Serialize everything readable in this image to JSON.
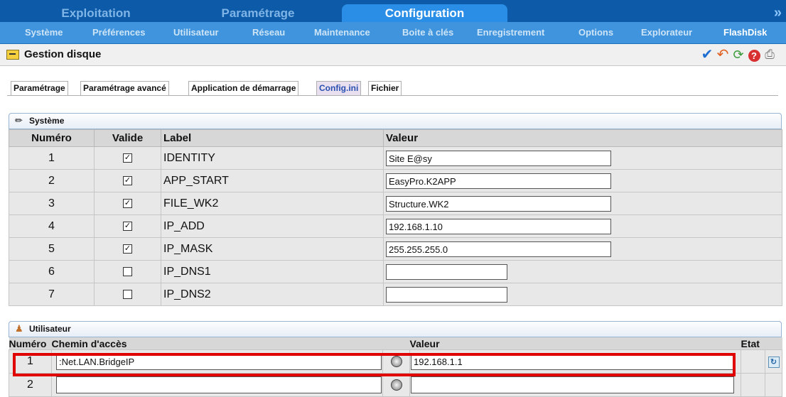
{
  "top_tabs": [
    "Exploitation",
    "Paramétrage",
    "Configuration"
  ],
  "top_more": "»",
  "subnav": [
    "Système",
    "Préférences",
    "Utilisateur",
    "Réseau",
    "Maintenance",
    "Boite à clés",
    "Enregistrement",
    "Options",
    "Explorateur",
    "FlashDisk"
  ],
  "title": "Gestion disque",
  "toolbar_icons": [
    "check-icon",
    "undo-icon",
    "refresh-icon",
    "help-icon",
    "print-icon"
  ],
  "subtabs": [
    "Paramétrage",
    "Paramétrage avancé",
    "Application de démarrage",
    "Config.ini",
    "Fichier"
  ],
  "systeme": {
    "title": "Système",
    "headers": {
      "num": "Numéro",
      "valid": "Valide",
      "label": "Label",
      "value": "Valeur"
    },
    "rows": [
      {
        "num": "1",
        "valid": true,
        "label": "IDENTITY",
        "value": "Site E@sy"
      },
      {
        "num": "2",
        "valid": true,
        "label": "APP_START",
        "value": "EasyPro.K2APP"
      },
      {
        "num": "3",
        "valid": true,
        "label": "FILE_WK2",
        "value": "Structure.WK2"
      },
      {
        "num": "4",
        "valid": true,
        "label": "IP_ADD",
        "value": "192.168.1.10"
      },
      {
        "num": "5",
        "valid": true,
        "label": "IP_MASK",
        "value": "255.255.255.0"
      },
      {
        "num": "6",
        "valid": false,
        "label": "IP_DNS1",
        "value": ""
      },
      {
        "num": "7",
        "valid": false,
        "label": "IP_DNS2",
        "value": ""
      }
    ]
  },
  "utilisateur": {
    "title": "Utilisateur",
    "headers": {
      "num": "Numéro",
      "path": "Chemin d'accès",
      "value": "Valeur",
      "state": "Etat"
    },
    "rows": [
      {
        "num": "1",
        "path": ":Net.LAN.BridgeIP",
        "value": "192.168.1.1"
      },
      {
        "num": "2",
        "path": "",
        "value": ""
      }
    ]
  },
  "checkmark": "✓"
}
